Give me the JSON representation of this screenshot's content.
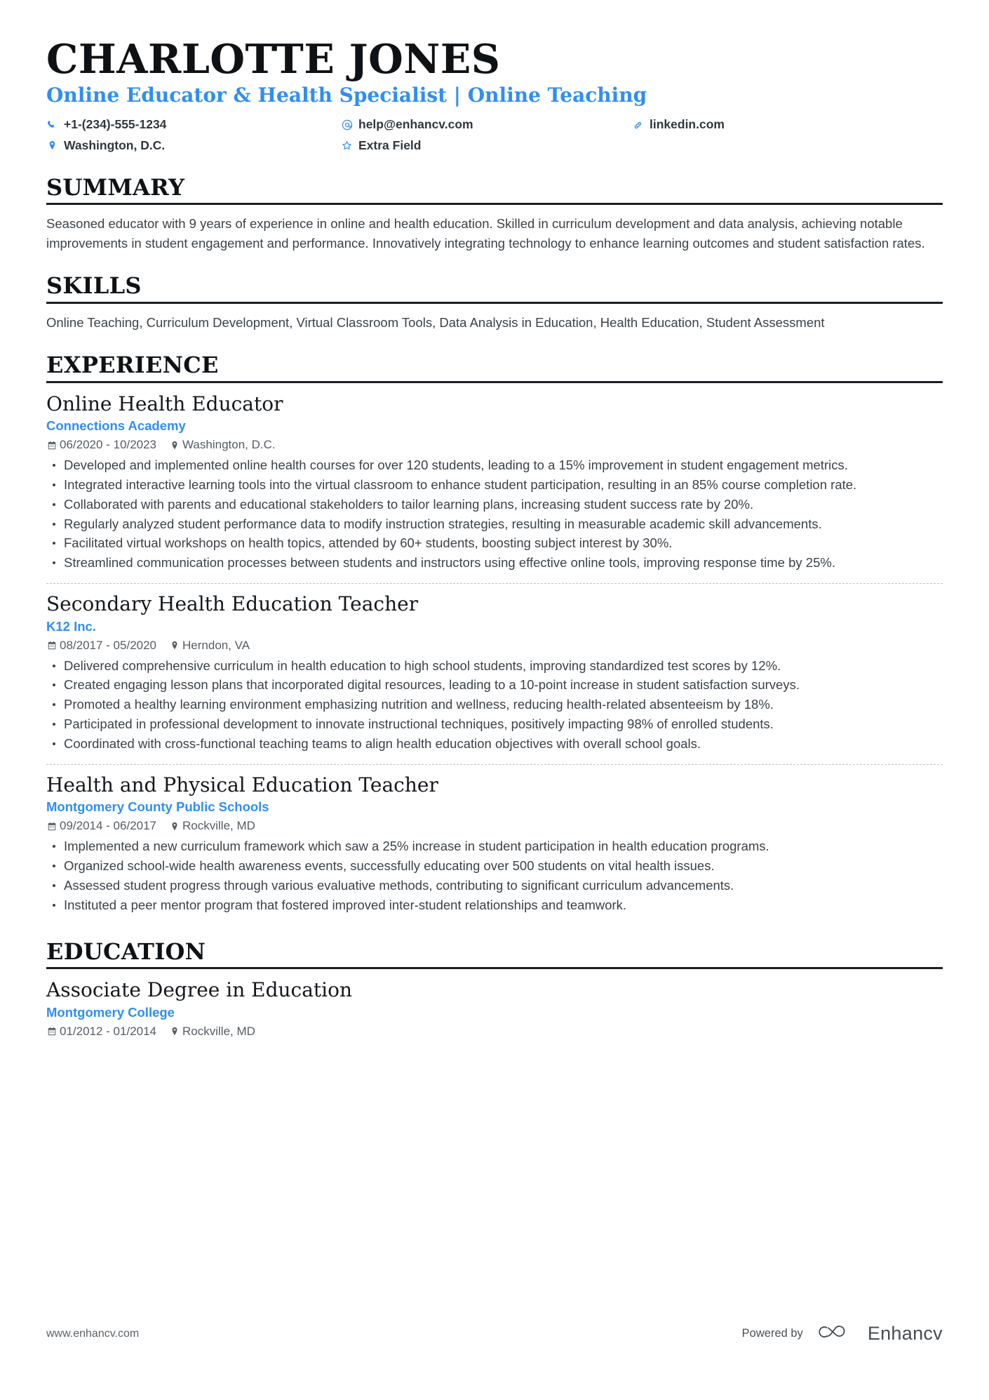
{
  "header": {
    "name": "CHARLOTTE JONES",
    "headline": "Online Educator & Health Specialist | Online Teaching",
    "accent_color": "#2f8ef4",
    "contacts": [
      {
        "icon": "phone-icon",
        "label": "+1-(234)-555-1234"
      },
      {
        "icon": "email-icon",
        "label": "help@enhancv.com"
      },
      {
        "icon": "link-icon",
        "label": "linkedin.com"
      },
      {
        "icon": "location-icon",
        "label": "Washington, D.C."
      },
      {
        "icon": "star-icon",
        "label": "Extra Field"
      }
    ]
  },
  "sections": {
    "summary": {
      "title": "SUMMARY",
      "text": "Seasoned educator with 9 years of experience in online and health education. Skilled in curriculum development and data analysis, achieving notable improvements in student engagement and performance. Innovatively integrating technology to enhance learning outcomes and student satisfaction rates."
    },
    "skills": {
      "title": "SKILLS",
      "text": "Online Teaching, Curriculum Development, Virtual Classroom Tools, Data Analysis in Education, Health Education, Student Assessment"
    },
    "experience": {
      "title": "EXPERIENCE",
      "entries": [
        {
          "title": "Online Health Educator",
          "org": "Connections Academy",
          "dates": "06/2020 - 10/2023",
          "location": "Washington, D.C.",
          "bullets": [
            "Developed and implemented online health courses for over 120 students, leading to a 15% improvement in student engagement metrics.",
            "Integrated interactive learning tools into the virtual classroom to enhance student participation, resulting in an 85% course completion rate.",
            "Collaborated with parents and educational stakeholders to tailor learning plans, increasing student success rate by 20%.",
            "Regularly analyzed student performance data to modify instruction strategies, resulting in measurable academic skill advancements.",
            "Facilitated virtual workshops on health topics, attended by 60+ students, boosting subject interest by 30%.",
            "Streamlined communication processes between students and instructors using effective online tools, improving response time by 25%."
          ]
        },
        {
          "title": "Secondary Health Education Teacher",
          "org": "K12 Inc.",
          "dates": "08/2017 - 05/2020",
          "location": "Herndon, VA",
          "bullets": [
            "Delivered comprehensive curriculum in health education to high school students, improving standardized test scores by 12%.",
            "Created engaging lesson plans that incorporated digital resources, leading to a 10-point increase in student satisfaction surveys.",
            "Promoted a healthy learning environment emphasizing nutrition and wellness, reducing health-related absenteeism by 18%.",
            "Participated in professional development to innovate instructional techniques, positively impacting 98% of enrolled students.",
            "Coordinated with cross-functional teaching teams to align health education objectives with overall school goals."
          ]
        },
        {
          "title": "Health and Physical Education Teacher",
          "org": "Montgomery County Public Schools",
          "dates": "09/2014 - 06/2017",
          "location": "Rockville, MD",
          "bullets": [
            "Implemented a new curriculum framework which saw a 25% increase in student participation in health education programs.",
            "Organized school-wide health awareness events, successfully educating over 500 students on vital health issues.",
            "Assessed student progress through various evaluative methods, contributing to significant curriculum advancements.",
            "Instituted a peer mentor program that fostered improved inter-student relationships and teamwork."
          ]
        }
      ]
    },
    "education": {
      "title": "EDUCATION",
      "entries": [
        {
          "title": "Associate Degree in Education",
          "org": "Montgomery College",
          "dates": "01/2012 - 01/2014",
          "location": "Rockville, MD"
        }
      ]
    }
  },
  "footer": {
    "url": "www.enhancv.com",
    "powered_by": "Powered by",
    "brand": "Enhancv"
  }
}
